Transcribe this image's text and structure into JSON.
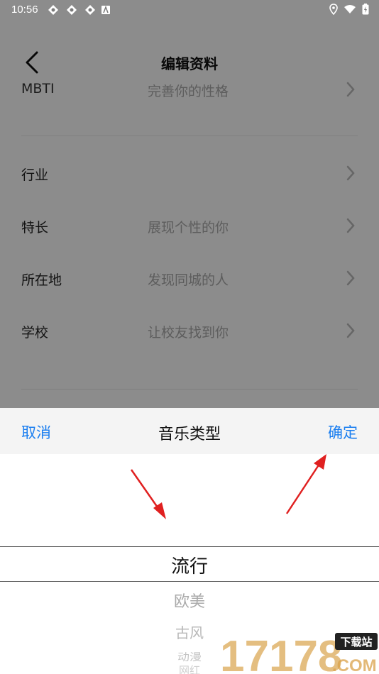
{
  "status_bar": {
    "time": "10:56"
  },
  "header": {
    "title": "编辑资料"
  },
  "rows": [
    {
      "label": "MBTI",
      "hint": "完善你的性格"
    },
    {
      "label": "行业",
      "hint": ""
    },
    {
      "label": "特长",
      "hint": "展现个性的你"
    },
    {
      "label": "所在地",
      "hint": "发现同城的人"
    },
    {
      "label": "学校",
      "hint": "让校友找到你"
    }
  ],
  "picker": {
    "cancel": "取消",
    "title": "音乐类型",
    "confirm": "确定",
    "selected": "流行",
    "options": [
      "欧美",
      "古风",
      "动漫",
      "网红"
    ]
  },
  "watermark": {
    "text": "17178",
    "badge": "下载站",
    "domain": ".COM"
  },
  "colors": {
    "accent": "#1a7ef0",
    "arrow": "#e02020"
  }
}
